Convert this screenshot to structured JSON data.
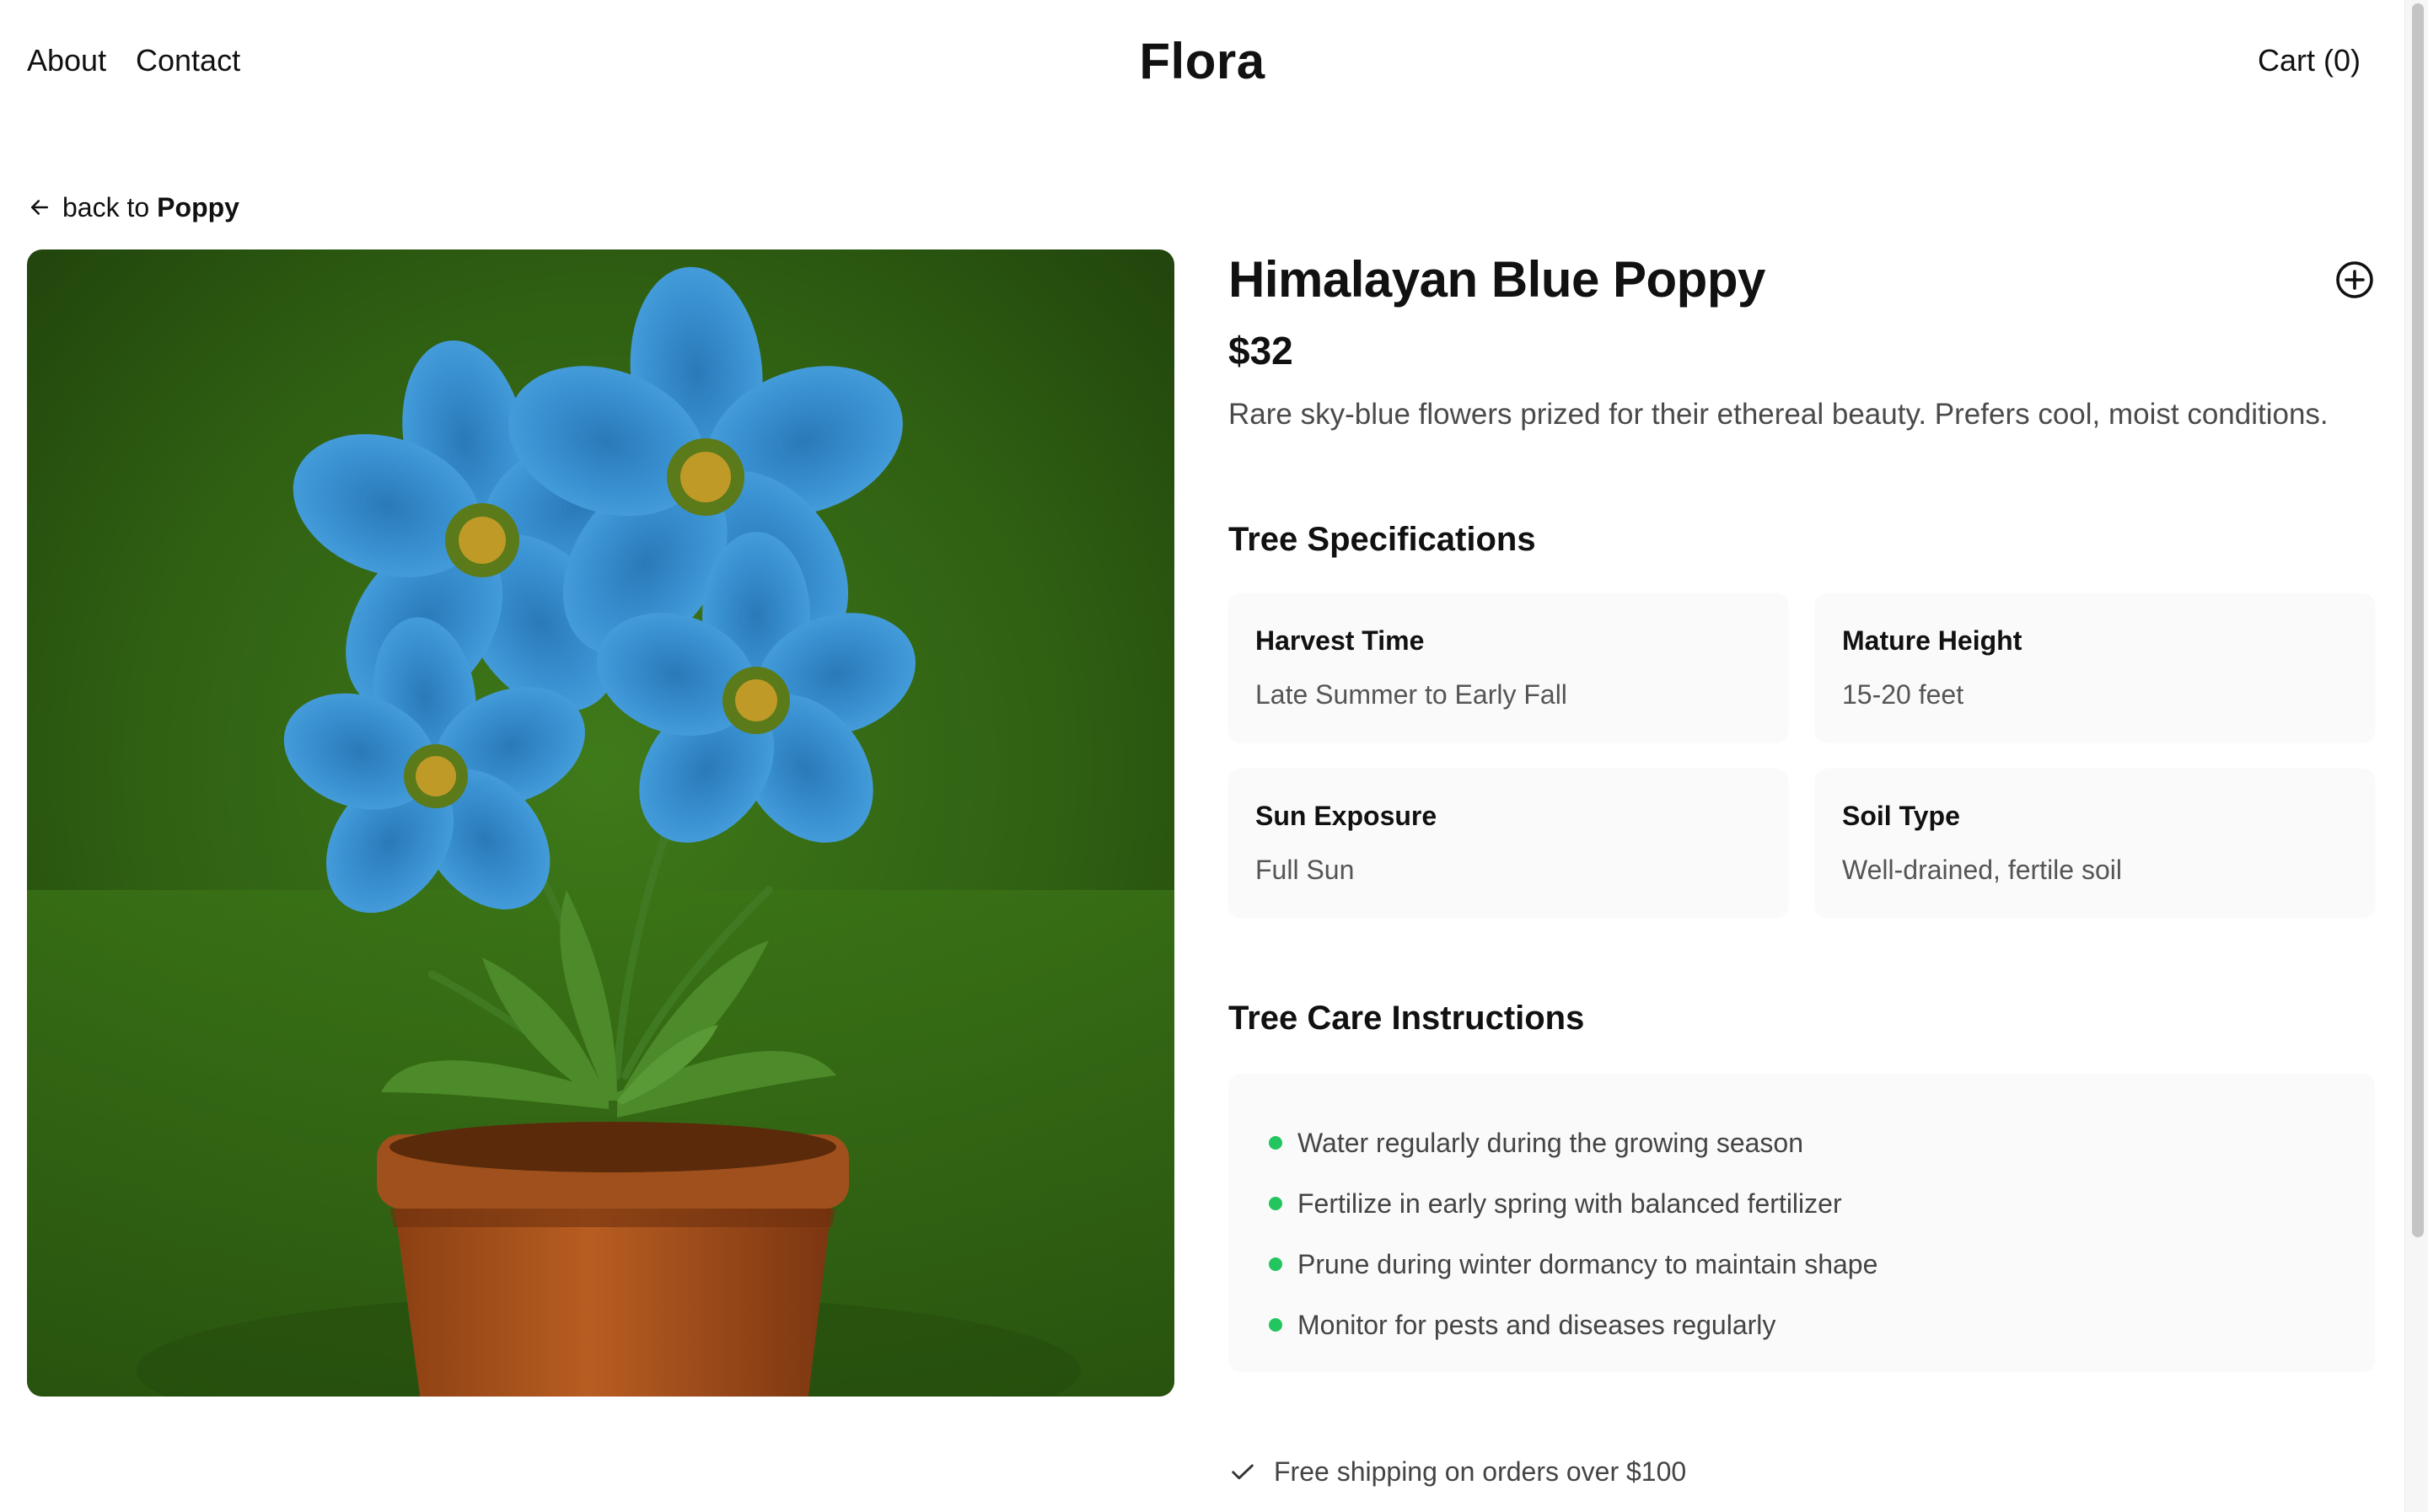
{
  "header": {
    "nav": [
      {
        "label": "About"
      },
      {
        "label": "Contact"
      }
    ],
    "brand": "Flora",
    "cart_label": "Cart (0)"
  },
  "back": {
    "prefix": "back to",
    "target": "Poppy"
  },
  "product": {
    "image_alt": "Blue poppies in terracotta pot",
    "title": "Himalayan Blue Poppy",
    "price": "$32",
    "description": "Rare sky-blue flowers prized for their ethereal beauty. Prefers cool, moist conditions.",
    "specs_title": "Tree Specifications",
    "specs": [
      {
        "label": "Harvest Time",
        "value": "Late Summer to Early Fall"
      },
      {
        "label": "Mature Height",
        "value": "15-20 feet"
      },
      {
        "label": "Sun Exposure",
        "value": "Full Sun"
      },
      {
        "label": "Soil Type",
        "value": "Well-drained, fertile soil"
      }
    ],
    "care_title": "Tree Care Instructions",
    "care": [
      "Water regularly during the growing season",
      "Fertilize in early spring with balanced fertilizer",
      "Prune during winter dormancy to maintain shape",
      "Monitor for pests and diseases regularly"
    ],
    "shipping": "Free shipping on orders over $100"
  },
  "colors": {
    "accent_dot": "#22c55e",
    "text": "#111111",
    "muted": "#4a4a4a",
    "card_bg": "#fafafa"
  },
  "icons": {
    "back": "arrow-left-icon",
    "add": "plus-circle-icon",
    "shipping": "check-icon"
  }
}
